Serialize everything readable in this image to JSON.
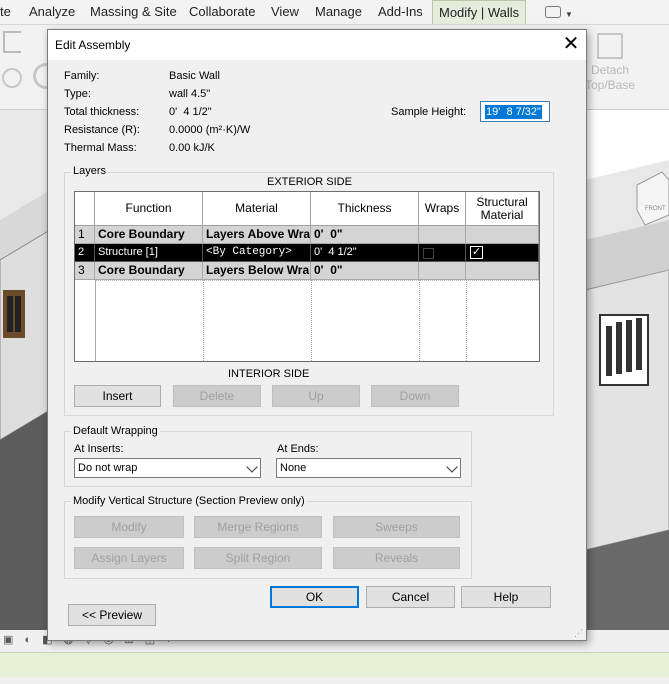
{
  "ribbon": {
    "tabs": [
      "te",
      "Analyze",
      "Massing & Site",
      "Collaborate",
      "View",
      "Manage",
      "Add-Ins",
      "Modify | Walls"
    ],
    "detach_label_1": "Detach",
    "detach_label_2": "Top/Base"
  },
  "dialog": {
    "title": "Edit Assembly",
    "close_glyph": "✕",
    "properties": {
      "family_label": "Family:",
      "family_value": "Basic Wall",
      "type_label": "Type:",
      "type_value": "wall 4.5\"",
      "thickness_label": "Total thickness:",
      "thickness_value": "0'  4 1/2\"",
      "resistance_label": "Resistance (R):",
      "resistance_value": "0.0000 (m²·K)/W",
      "thermal_label": "Thermal Mass:",
      "thermal_value": "0.00 kJ/K"
    },
    "sample_height_label": "Sample Height:",
    "sample_height_value": "19'  8 7/32\"",
    "layers": {
      "group_title": "Layers",
      "exterior_side": "EXTERIOR SIDE",
      "interior_side": "INTERIOR SIDE",
      "columns": [
        "Function",
        "Material",
        "Thickness",
        "Wraps",
        "Structural Material"
      ],
      "rows": [
        {
          "num": "1",
          "function": "Core Boundary",
          "material": "Layers Above Wra",
          "thickness": "0'  0\"",
          "wraps": false,
          "structural": false
        },
        {
          "num": "2",
          "function": "Structure [1]",
          "material": "<By Category>",
          "thickness": "0'  4 1/2\"",
          "wraps": false,
          "structural": true
        },
        {
          "num": "3",
          "function": "Core Boundary",
          "material": "Layers Below Wra",
          "thickness": "0'  0\"",
          "wraps": false,
          "structural": false
        }
      ],
      "buttons": {
        "insert": "Insert",
        "delete": "Delete",
        "up": "Up",
        "down": "Down"
      }
    },
    "wrapping": {
      "group_title": "Default Wrapping",
      "at_inserts_label": "At Inserts:",
      "at_inserts_value": "Do not wrap",
      "at_ends_label": "At Ends:",
      "at_ends_value": "None"
    },
    "vertical": {
      "group_title": "Modify Vertical Structure (Section Preview only)",
      "buttons": {
        "modify": "Modify",
        "merge": "Merge Regions",
        "sweeps": "Sweeps",
        "assign": "Assign Layers",
        "split": "Split Region",
        "reveals": "Reveals"
      }
    },
    "footer": {
      "ok": "OK",
      "cancel": "Cancel",
      "help": "Help",
      "preview": "<< Preview"
    }
  },
  "colors": {
    "selection": "#0078d7",
    "status_bar": "#e8f0d6",
    "active_tab": "#e6ecdc",
    "selected_row": "#000000"
  }
}
